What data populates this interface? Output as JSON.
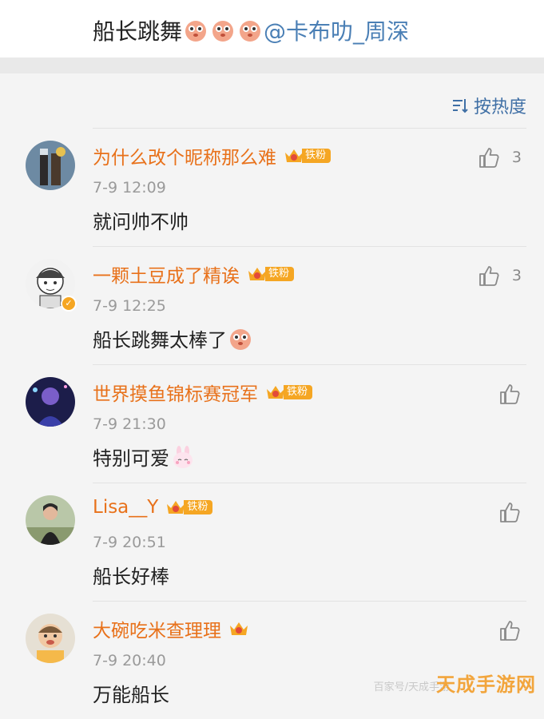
{
  "post": {
    "text_lead": "船长跳舞",
    "mention": "@卡布叻_周深"
  },
  "sort": {
    "label": "按热度"
  },
  "comments": [
    {
      "username": "为什么改个昵称那么难",
      "badge": "铁粉",
      "time": "7-9 12:09",
      "content": "就问帅不帅",
      "likes": "3"
    },
    {
      "username": "一颗土豆成了精诶",
      "badge": "铁粉",
      "time": "7-9 12:25",
      "content": "船长跳舞太棒了",
      "likes": "3"
    },
    {
      "username": "世界摸鱼锦标赛冠军",
      "badge": "铁粉",
      "time": "7-9 21:30",
      "content": "特别可爱",
      "likes": ""
    },
    {
      "username": "Lisa__Y",
      "badge": "铁粉",
      "time": "7-9 20:51",
      "content": "船长好棒",
      "likes": ""
    },
    {
      "username": "大碗吃米查理理",
      "badge": "",
      "time": "7-9 20:40",
      "content": "万能船长",
      "likes": ""
    }
  ],
  "watermark": {
    "main": "天成手游网",
    "sub": "百家号/天成手游"
  },
  "colors": {
    "username": "#e8711a",
    "mention": "#4a7fb5",
    "badge": "#f5a623"
  }
}
